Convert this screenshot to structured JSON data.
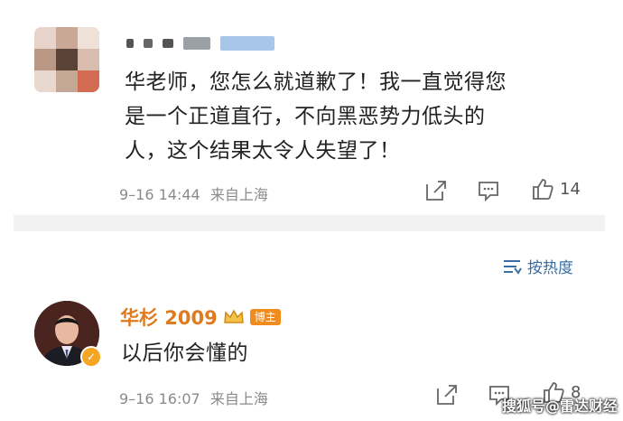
{
  "comment1": {
    "text_line1": "华老师，您怎么就道歉了！我一直觉得您",
    "text_line2": "是一个正道直行，不向黑恶势力低头的",
    "text_line3": "人，这个结果太令人失望了！",
    "time": "9–16 14:44",
    "location": "来自上海",
    "like_count": "14"
  },
  "sort": {
    "label": "按热度"
  },
  "comment2": {
    "username": "华杉 2009",
    "badge": "博主",
    "text": "以后你会懂的",
    "time": "9–16 16:07",
    "location": "来自上海",
    "like_count": "8"
  },
  "watermark": "搜狐号@雷达财经",
  "colors": {
    "accent_orange": "#e07a1f",
    "link_blue": "#3a6ea5",
    "meta_gray": "#8a8a8a"
  },
  "icons": [
    "share-icon",
    "comment-icon",
    "like-icon",
    "sort-icon",
    "crown-icon",
    "verified-icon"
  ]
}
